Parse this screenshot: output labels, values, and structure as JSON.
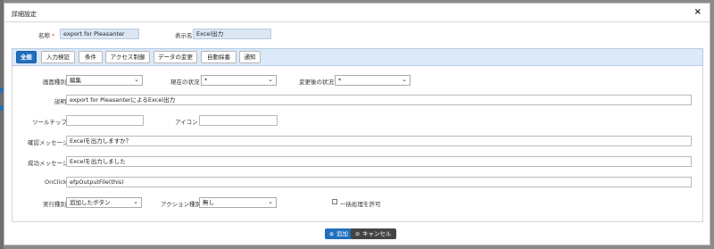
{
  "dialog": {
    "title": "詳細設定",
    "close_icon": "×"
  },
  "top": {
    "name_label": "名称",
    "required_mark": "*",
    "name_value": "export for Pleasanter",
    "display_name_label": "表示名",
    "display_name_value": "Excel出力"
  },
  "tabs": [
    {
      "label": "全般",
      "active": true
    },
    {
      "label": "入力検証"
    },
    {
      "label": "条件"
    },
    {
      "label": "アクセス制御"
    },
    {
      "label": "データの変更"
    },
    {
      "label": "自動採番"
    },
    {
      "label": "通知"
    }
  ],
  "form": {
    "screen_type_label": "画面種別",
    "screen_type_value": "編集",
    "current_status_label": "現在の状況",
    "current_status_value": "*",
    "new_status_label": "変更後の状況",
    "new_status_value": "*",
    "description_label": "説明",
    "description_value": "export for PleasanterによるExcel出力",
    "tooltip_label": "ツールチップ",
    "tooltip_value": "",
    "icon_label": "アイコン",
    "icon_value": "",
    "confirm_label": "確認メッセージ",
    "confirm_value": "Excelを出力しますか？",
    "success_label": "成功メッセージ",
    "success_value": "Excelを出力しました",
    "onclick_label": "OnClick",
    "onclick_value": "efpOutputFile(this)",
    "exec_type_label": "実行種別",
    "exec_type_value": "追加したボタン",
    "action_type_label": "アクション種別",
    "action_type_value": "無し",
    "bulk_label": "一括処理を許可",
    "bulk_checked": false
  },
  "footer": {
    "add_icon": "⊕",
    "add_label": "追加",
    "cancel_icon": "⊘",
    "cancel_label": "キャンセル"
  },
  "colors": {
    "accent": "#1f6fbf",
    "tab_bar": "#dbe9f8",
    "highlight_field": "#dbe6f5"
  }
}
